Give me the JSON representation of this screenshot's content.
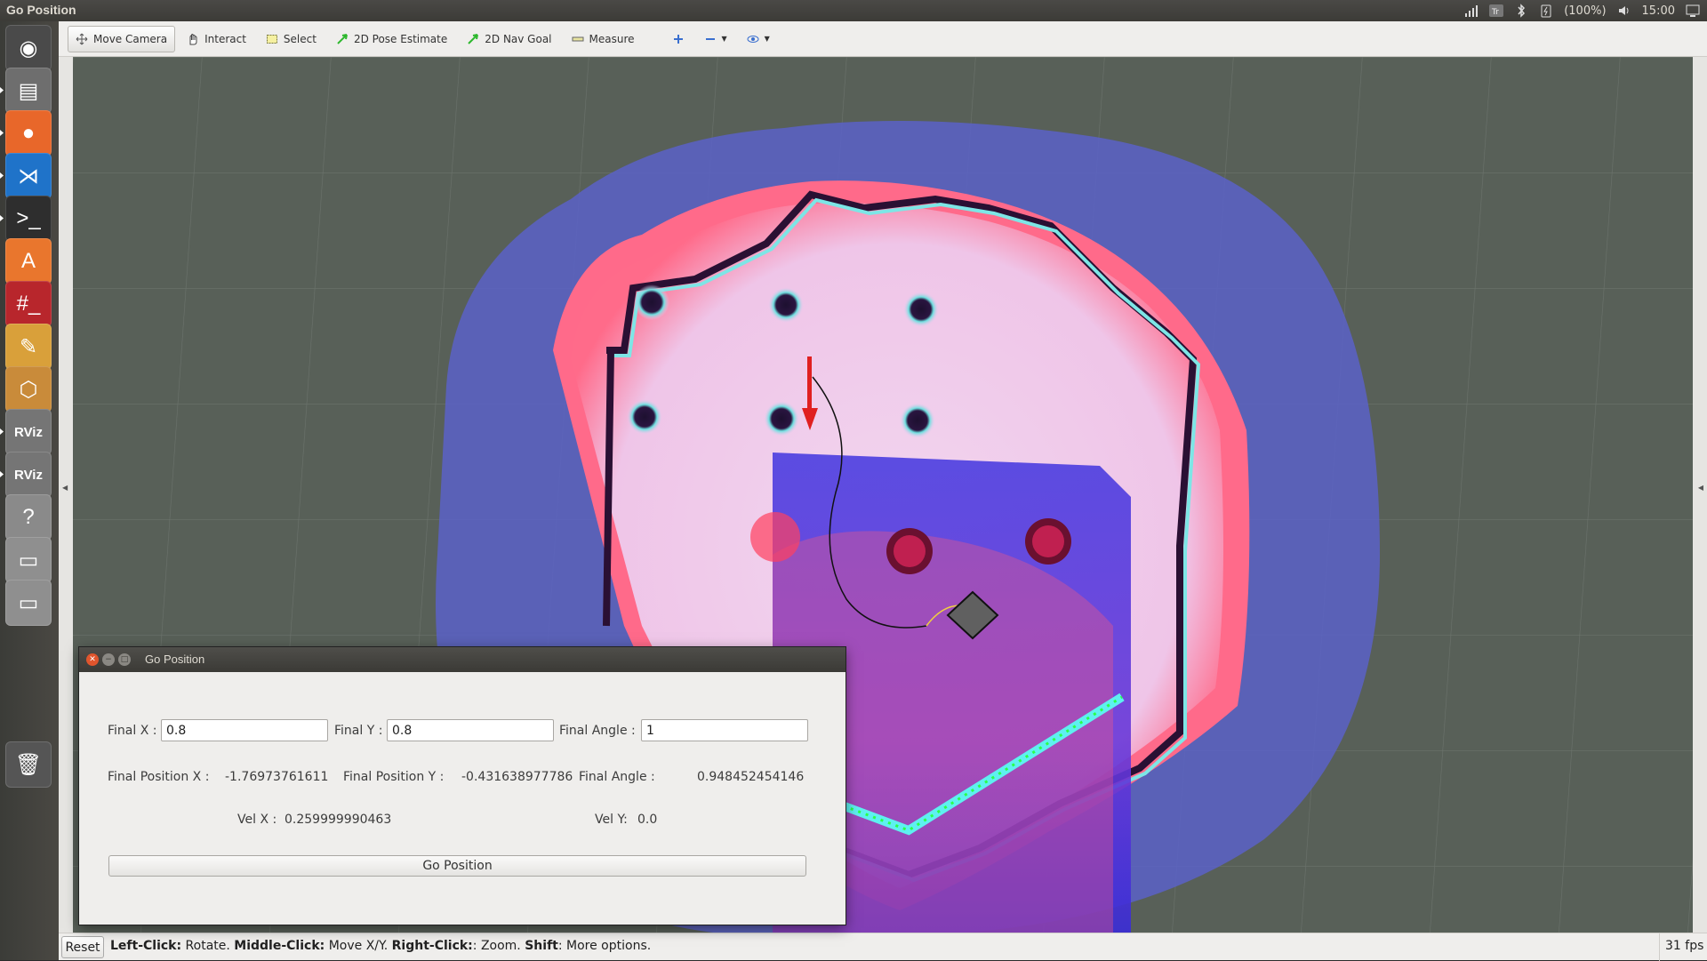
{
  "window_title": "Go Position",
  "tray": {
    "battery": "(100%)",
    "clock": "15:00"
  },
  "launcher": [
    {
      "name": "ubuntu-dash-icon",
      "glyph": "◉"
    },
    {
      "name": "files-icon",
      "glyph": "▤"
    },
    {
      "name": "firefox-icon",
      "glyph": "●"
    },
    {
      "name": "vscode-icon",
      "glyph": "⋊"
    },
    {
      "name": "terminal-icon",
      "glyph": ">_"
    },
    {
      "name": "software-center-icon",
      "glyph": "A"
    },
    {
      "name": "root-terminal-icon",
      "glyph": "#_"
    },
    {
      "name": "text-editor-icon",
      "glyph": "✎"
    },
    {
      "name": "package-icon",
      "glyph": "⬡"
    },
    {
      "name": "rviz-icon",
      "glyph": "RViz"
    },
    {
      "name": "rviz-icon",
      "glyph": "RViz"
    },
    {
      "name": "help-icon",
      "glyph": "?"
    },
    {
      "name": "drive-icon",
      "glyph": "▭"
    },
    {
      "name": "drive-icon",
      "glyph": "▭"
    },
    {
      "name": "trash-icon",
      "glyph": "🗑"
    }
  ],
  "toolbar": {
    "move_camera": "Move Camera",
    "interact": "Interact",
    "select": "Select",
    "pose_estimate": "2D Pose Estimate",
    "nav_goal": "2D Nav Goal",
    "measure": "Measure"
  },
  "status": {
    "reset": "Reset",
    "hint_parts": [
      {
        "b": "Left-Click:",
        "t": " Rotate. "
      },
      {
        "b": "Middle-Click:",
        "t": " Move X/Y. "
      },
      {
        "b": "Right-Click:",
        "t": ": Zoom. "
      },
      {
        "b": "Shift",
        "t": ": More options."
      }
    ],
    "fps": "31 fps"
  },
  "dialog": {
    "title": "Go Position",
    "final_x_label": "Final X :",
    "final_x_value": "0.8",
    "final_y_label": "Final Y :",
    "final_y_value": "0.8",
    "final_angle_label": "Final Angle :",
    "final_angle_value": "1",
    "pos_x_label": "Final Position X :",
    "pos_x_value": "-1.76973761611",
    "pos_y_label": "Final Position Y :",
    "pos_y_value": "-0.431638977786",
    "angle_label": "Final Angle :",
    "angle_value": "0.948452454146",
    "vel_x_label": "Vel X :",
    "vel_x_value": "0.259999990463",
    "vel_y_label": "Vel Y:",
    "vel_y_value": "0.0",
    "go_button": "Go Position"
  }
}
